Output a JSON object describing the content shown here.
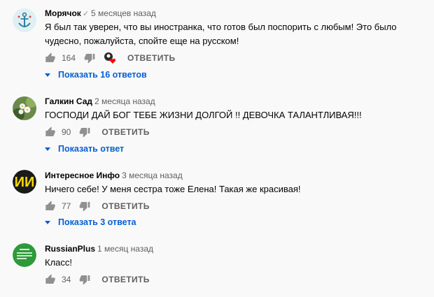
{
  "comments": [
    {
      "author": "Морячок",
      "verified": true,
      "time": "5 месяцев назад",
      "text": "Я был так уверен, что вы иностранка, что готов был поспорить с любым! Это было чудесно, пожалуйста, спойте еще на русском!",
      "likes": "164",
      "reply_label": "ОТВЕТИТЬ",
      "replies_label": "Показать 16 ответов",
      "creator_heart": true
    },
    {
      "author": "Галкин Сад",
      "time": "2 месяца назад",
      "text": "ГОСПОДИ ДАЙ БОГ ТЕБЕ ЖИЗНИ ДОЛГОЙ !! ДЕВОЧКА ТАЛАНТЛИВАЯ!!!",
      "likes": "90",
      "reply_label": "ОТВЕТИТЬ",
      "replies_label": "Показать ответ"
    },
    {
      "author": "Интересное Инфо",
      "time": "3 месяца назад",
      "text": "Ничего себе! У меня сестра тоже Елена! Такая же красивая!",
      "likes": "77",
      "reply_label": "ОТВЕТИТЬ",
      "replies_label": "Показать 3 ответа"
    },
    {
      "author": "RussianPlus",
      "time": "1 месяц назад",
      "text": "Класс!",
      "likes": "34",
      "reply_label": "ОТВЕТИТЬ"
    }
  ],
  "colors": {
    "link": "#065fd4",
    "meta": "#606060",
    "heart": "#ff0000"
  },
  "avatar_icons": [
    "anchor-icon",
    "flower-photo",
    "logo-ii",
    "green-plus-logo"
  ]
}
